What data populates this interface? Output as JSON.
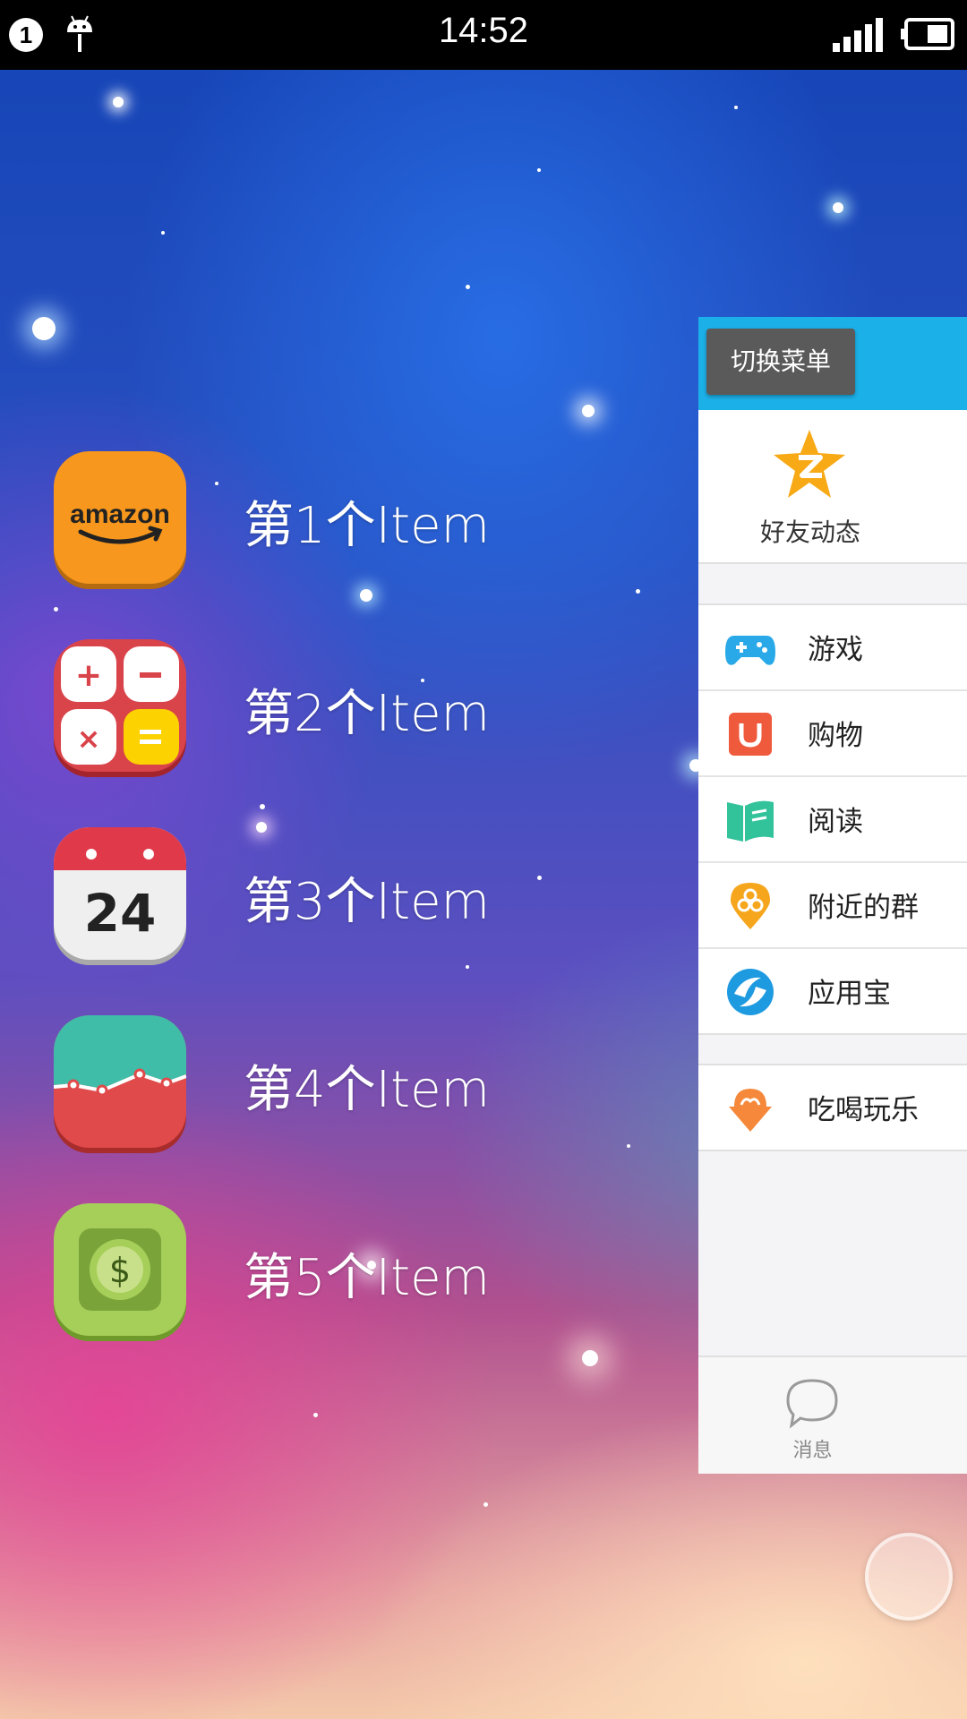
{
  "status_bar": {
    "time": "14:52",
    "notification_count": "1"
  },
  "items": [
    {
      "label": "第1个Item",
      "icon": "amazon-icon",
      "brand_text": "amazon"
    },
    {
      "label": "第2个Item",
      "icon": "calculator-icon"
    },
    {
      "label": "第3个Item",
      "icon": "calendar-icon",
      "day": "24"
    },
    {
      "label": "第4个Item",
      "icon": "chart-icon"
    },
    {
      "label": "第5个Item",
      "icon": "money-icon"
    }
  ],
  "menu": {
    "switch_button": "切换菜单",
    "friend_feed": "好友动态",
    "group1": [
      {
        "label": "游戏",
        "icon": "gamepad-icon"
      },
      {
        "label": "购物",
        "icon": "shopping-icon"
      },
      {
        "label": "阅读",
        "icon": "book-icon"
      },
      {
        "label": "附近的群",
        "icon": "nearby-group-icon"
      },
      {
        "label": "应用宝",
        "icon": "app-store-icon"
      }
    ],
    "group2": [
      {
        "label": "吃喝玩乐",
        "icon": "food-fun-icon"
      }
    ],
    "footer_label": "消息"
  },
  "colors": {
    "menu_header": "#1cb0e8",
    "switch_button": "#5a5a5a"
  }
}
